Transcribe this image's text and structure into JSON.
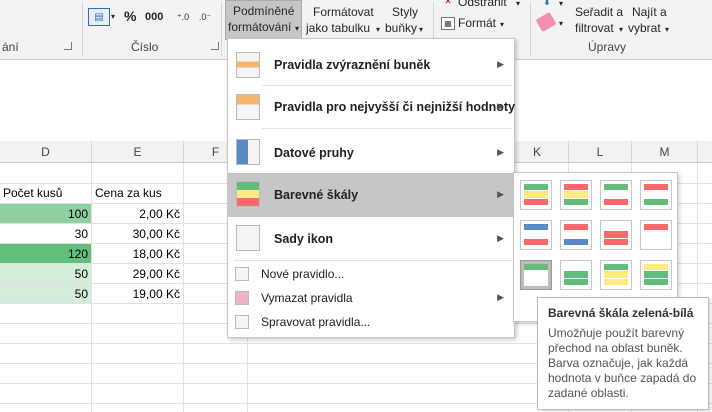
{
  "ribbon": {
    "group_left_label": "ání",
    "group_number_label": "Číslo",
    "group_edit_label": "Úpravy",
    "percent_symbol": "%",
    "thousands_symbol": "000",
    "cf_button_line1": "Podmíněné",
    "cf_button_line2": "formátování",
    "format_table_line1": "Formátovat",
    "format_table_line2": "jako tabulku",
    "styles_line1": "Styly",
    "styles_line2": "buňky",
    "delete_label": "Odstranit",
    "format_label": "Formát",
    "sort_line1": "Seřadit a",
    "sort_line2": "filtrovat",
    "find_line1": "Najít a",
    "find_line2": "vybrat"
  },
  "columns": [
    "D",
    "E",
    "F",
    "K",
    "L",
    "M"
  ],
  "sheet": {
    "header_d": "Počet kusů",
    "header_e": "Cena za kus",
    "rows": [
      {
        "d": "100",
        "e": "2,00 Kč",
        "color": "#8fd0a0"
      },
      {
        "d": "30",
        "e": "30,00 Kč",
        "color": "#ffffff"
      },
      {
        "d": "120",
        "e": "18,00 Kč",
        "color": "#63be7b"
      },
      {
        "d": "50",
        "e": "29,00 Kč",
        "color": "#d4edd9"
      },
      {
        "d": "50",
        "e": "19,00 Kč",
        "color": "#d4edd9"
      }
    ]
  },
  "menu": {
    "items": [
      {
        "label": "Pravidla zvýraznění buněk"
      },
      {
        "label": "Pravidla pro nejvyšší či nejnižší hodnoty"
      },
      {
        "label": "Datové pruhy"
      },
      {
        "label": "Barevné škály"
      },
      {
        "label": "Sady ikon"
      },
      {
        "label": "Nové pravidlo..."
      },
      {
        "label": "Vymazat pravidla"
      },
      {
        "label": "Spravovat pravidla..."
      }
    ]
  },
  "submenu": {
    "scales": [
      [
        "#63be7b",
        "#ffeb84",
        "#f8696b"
      ],
      [
        "#f8696b",
        "#ffeb84",
        "#63be7b"
      ],
      [
        "#63be7b",
        "#ffffff",
        "#f8696b"
      ],
      [
        "#f8696b",
        "#ffffff",
        "#63be7b"
      ],
      [
        "#5a8ac6",
        "#ffffff",
        "#f8696b"
      ],
      [
        "#f8696b",
        "#ffffff",
        "#5a8ac6"
      ],
      [
        "#ffffff",
        "#f8696b",
        "#f8696b"
      ],
      [
        "#f8696b",
        "#ffffff",
        "#ffffff"
      ],
      [
        "#63be7b",
        "#ffffff",
        "#ffffff"
      ],
      [
        "#ffffff",
        "#63be7b",
        "#63be7b"
      ],
      [
        "#63be7b",
        "#ffeb84",
        "#ffeb84"
      ],
      [
        "#ffeb84",
        "#63be7b",
        "#63be7b"
      ]
    ]
  },
  "tooltip": {
    "title": "Barevná škála zelená-bílá",
    "description": "Umožňuje použít barevný přechod na oblast buněk. Barva označuje, jak každá hodnota v buňce zapadá do zadané oblasti."
  }
}
